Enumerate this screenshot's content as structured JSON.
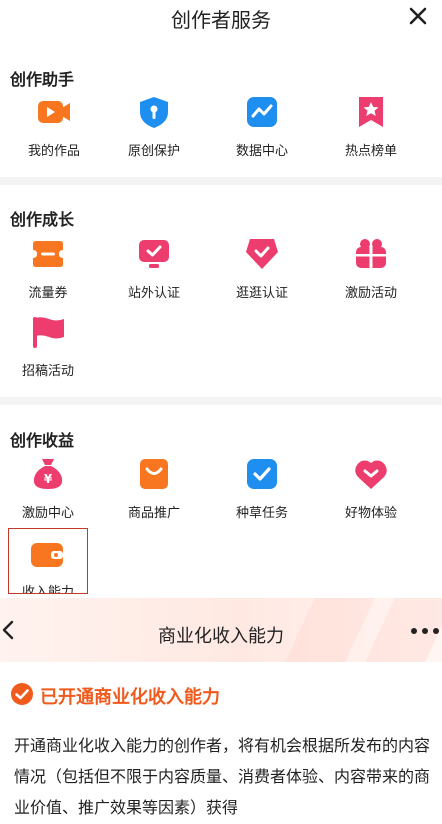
{
  "header": {
    "title": "创作者服务"
  },
  "sections": [
    {
      "title": "创作助手",
      "items": [
        {
          "label": "我的作品",
          "icon": "video-icon",
          "color": "#f7761f"
        },
        {
          "label": "原创保护",
          "icon": "shield-icon",
          "color": "#1e8ff0"
        },
        {
          "label": "数据中心",
          "icon": "chart-icon",
          "color": "#1e8ff0"
        },
        {
          "label": "热点榜单",
          "icon": "bookmark-star-icon",
          "color": "#ec3d6e"
        }
      ]
    },
    {
      "title": "创作成长",
      "items": [
        {
          "label": "流量券",
          "icon": "ticket-icon",
          "color": "#f7761f"
        },
        {
          "label": "站外认证",
          "icon": "monitor-check-icon",
          "color": "#ec3d6e"
        },
        {
          "label": "逛逛认证",
          "icon": "badge-check-icon",
          "color": "#ec3d6e"
        },
        {
          "label": "激励活动",
          "icon": "gift-icon",
          "color": "#ec3d6e"
        },
        {
          "label": "招稿活动",
          "icon": "flag-icon",
          "color": "#ec3d6e"
        }
      ]
    },
    {
      "title": "创作收益",
      "items": [
        {
          "label": "激励中心",
          "icon": "money-bag-icon",
          "color": "#ec3d6e"
        },
        {
          "label": "商品推广",
          "icon": "shopping-bag-icon",
          "color": "#f7761f"
        },
        {
          "label": "种草任务",
          "icon": "task-check-icon",
          "color": "#1e8ff0"
        },
        {
          "label": "好物体验",
          "icon": "heart-chevron-icon",
          "color": "#ec3d6e"
        },
        {
          "label": "收入能力",
          "icon": "wallet-icon",
          "color": "#f7761f"
        }
      ]
    }
  ],
  "panel": {
    "title": "商业化收入能力",
    "status": "已开通商业化收入能力",
    "description": "开通商业化收入能力的创作者，将有机会根据所发布的内容情况（包括但不限于内容质量、消费者体验、内容带来的商业价值、推广效果等因素）获得"
  },
  "colors": {
    "accent": "#f05a1c",
    "blue": "#1e8ff0",
    "pink": "#ec3d6e",
    "orange": "#f7761f"
  }
}
